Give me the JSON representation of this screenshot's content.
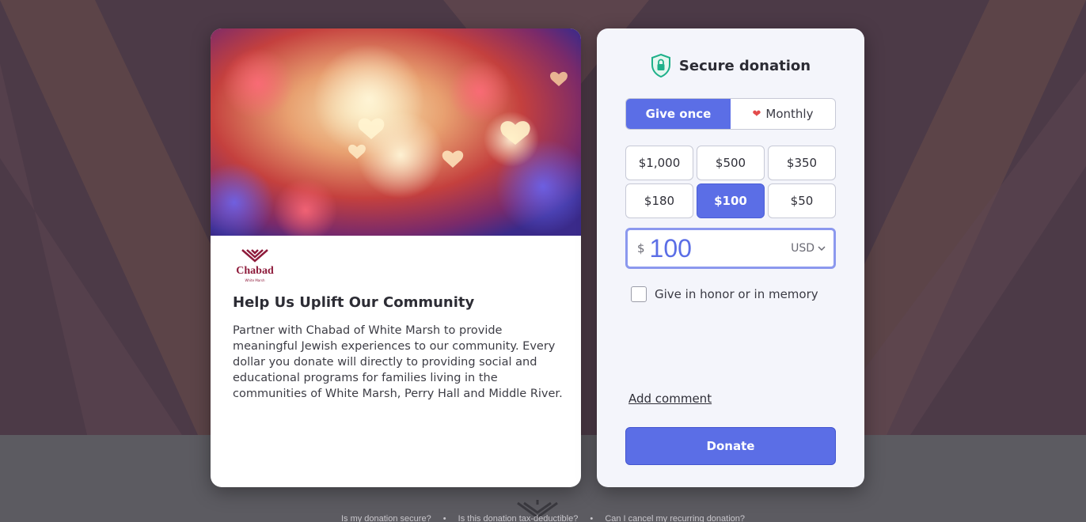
{
  "campaign": {
    "org_logo_text": "Chabad",
    "org_logo_subtext": "White Marsh",
    "title": "Help Us Uplift Our Community",
    "description": "Partner with Chabad of White Marsh to provide meaningful Jewish experiences to our community. Every dollar you donate will directly to providing social and educational programs for families living in the communities of White Marsh, Perry Hall and Middle River."
  },
  "donation": {
    "header_title": "Secure donation",
    "header_icon": "shield-lock-icon",
    "frequency": {
      "options": [
        "Give once",
        "Monthly"
      ],
      "selected": "Give once"
    },
    "amounts": [
      "$1,000",
      "$500",
      "$350",
      "$180",
      "$100",
      "$50"
    ],
    "selected_amount": "$100",
    "input": {
      "currency_symbol": "$",
      "value": "100",
      "currency_code": "USD"
    },
    "honor_label": "Give in honor or in memory",
    "add_comment_label": "Add comment",
    "donate_label": "Donate"
  },
  "footer": {
    "links": [
      "Is my donation secure?",
      "Is this donation tax-deductible?",
      "Can I cancel my recurring donation?"
    ],
    "separator": "•"
  },
  "colors": {
    "accent": "#5b6ee6",
    "backdrop": "#4c3a47",
    "brand": "#8e1b3b",
    "shield": "#1fb08a"
  }
}
